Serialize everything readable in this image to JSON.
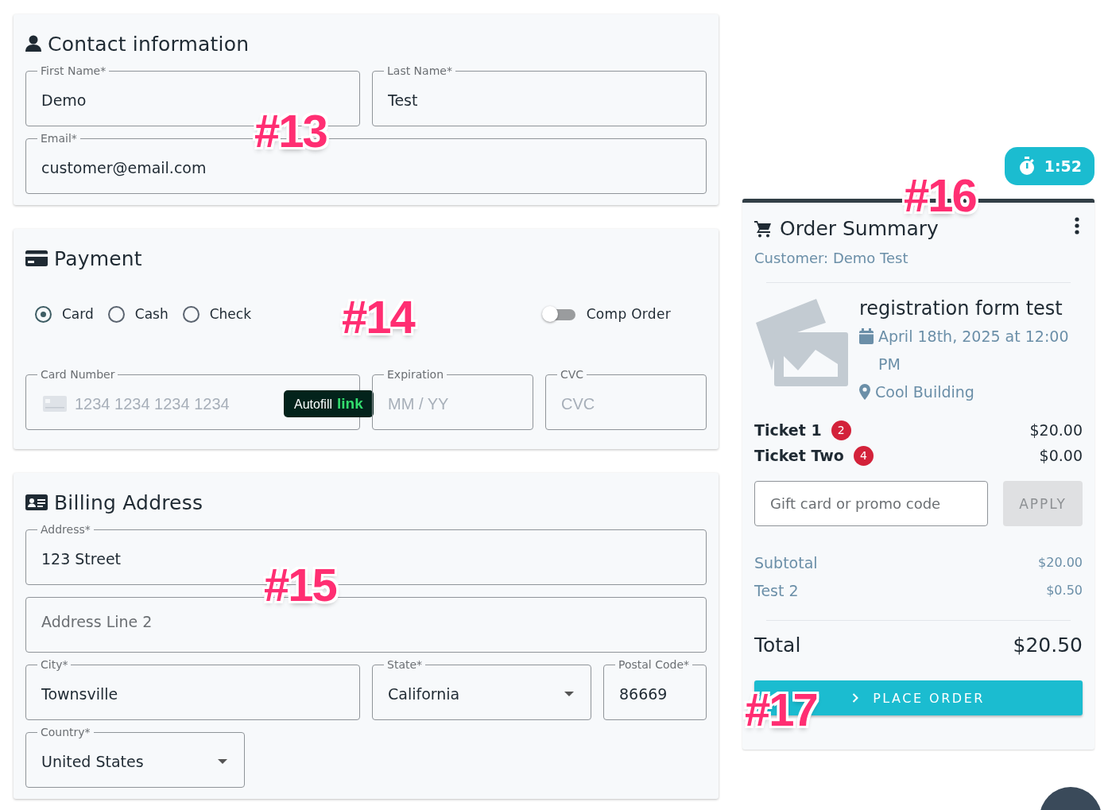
{
  "contact": {
    "title": "Contact information",
    "rows": [
      [
        {
          "kind": "text",
          "label": "First Name*",
          "value": "Demo"
        },
        {
          "kind": "text",
          "label": "Last Name*",
          "value": "Test"
        }
      ],
      [
        {
          "kind": "text",
          "label": "Email*",
          "value": "customer@email.com"
        }
      ]
    ]
  },
  "payment": {
    "title": "Payment",
    "methods": [
      {
        "label": "Card",
        "selected": true
      },
      {
        "label": "Cash",
        "selected": false
      },
      {
        "label": "Check",
        "selected": false
      }
    ],
    "comp_order": {
      "label": "Comp Order",
      "on": false
    },
    "card_fields": [
      {
        "kind": "card",
        "label": "Card Number",
        "placeholder": "1234 1234 1234 1234",
        "autofill": {
          "text": "Autofill",
          "brand": "link"
        }
      },
      {
        "kind": "text",
        "label": "Expiration",
        "placeholder": "MM / YY"
      },
      {
        "kind": "text",
        "label": "CVC",
        "placeholder": "CVC"
      }
    ]
  },
  "billing": {
    "title": "Billing Address",
    "rows": [
      [
        {
          "kind": "text",
          "label": "Address*",
          "value": "123 Street"
        }
      ],
      [
        {
          "kind": "text",
          "placeholder": "Address Line 2"
        }
      ],
      [
        {
          "kind": "text",
          "label": "City*",
          "value": "Townsville"
        },
        {
          "kind": "select",
          "label": "State*",
          "value": "California"
        },
        {
          "kind": "text",
          "label": "Postal Code*",
          "value": "86669"
        }
      ],
      [
        {
          "kind": "select",
          "label": "Country*",
          "value": "United States"
        }
      ]
    ]
  },
  "timer": "1:52",
  "order_summary": {
    "title": "Order Summary",
    "customer": "Customer: Demo Test",
    "event": {
      "name": "registration form test",
      "date": "April 18th, 2025 at 12:00 PM",
      "venue": "Cool Building"
    },
    "tickets": [
      {
        "name": "Ticket 1",
        "count": "2",
        "price": "$20.00"
      },
      {
        "name": "Ticket Two",
        "count": "4",
        "price": "$0.00"
      }
    ],
    "promo": {
      "placeholder": "Gift card or promo code",
      "button": "APPLY",
      "disabled": true
    },
    "lines": [
      {
        "label": "Subtotal",
        "amount": "$20.00"
      },
      {
        "label": "Test 2",
        "amount": "$0.50"
      }
    ],
    "total": {
      "label": "Total",
      "amount": "$20.50"
    },
    "place_order": "PLACE ORDER"
  },
  "annotations": [
    "#13",
    "#14",
    "#15",
    "#16",
    "#17"
  ]
}
